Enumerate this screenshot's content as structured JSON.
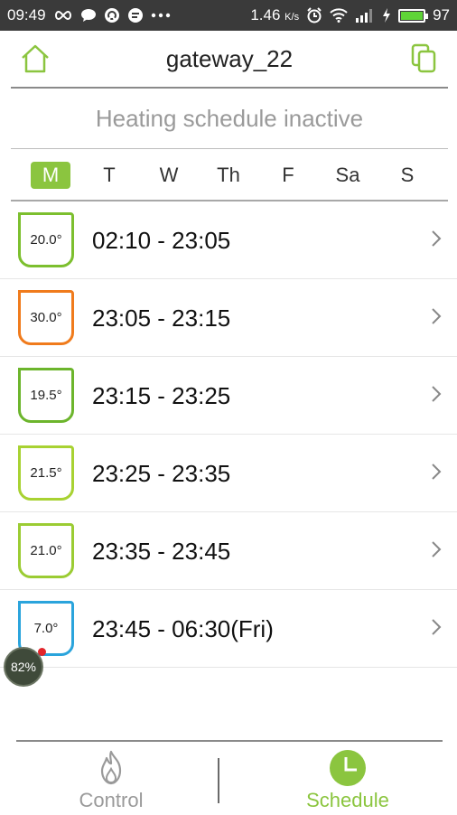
{
  "status_bar": {
    "time": "09:49",
    "speed": "1.46",
    "speed_unit": "K/s",
    "battery": "97"
  },
  "header": {
    "title": "gateway_22"
  },
  "schedule_status": "Heating schedule inactive",
  "days": [
    {
      "label": "M",
      "active": true
    },
    {
      "label": "T",
      "active": false
    },
    {
      "label": "W",
      "active": false
    },
    {
      "label": "Th",
      "active": false
    },
    {
      "label": "F",
      "active": false
    },
    {
      "label": "Sa",
      "active": false
    },
    {
      "label": "S",
      "active": false
    }
  ],
  "schedule_items": [
    {
      "temp": "20.0°",
      "time": "02:10 - 23:05",
      "color": "#7cbf2e"
    },
    {
      "temp": "30.0°",
      "time": "23:05 - 23:15",
      "color": "#f07b1c"
    },
    {
      "temp": "19.5°",
      "time": "23:15 - 23:25",
      "color": "#6cb52c"
    },
    {
      "temp": "21.5°",
      "time": "23:25 - 23:35",
      "color": "#a8d232"
    },
    {
      "temp": "21.0°",
      "time": "23:35 - 23:45",
      "color": "#9bcc33"
    },
    {
      "temp": "7.0°",
      "time": "23:45 - 06:30(Fri)",
      "color": "#2aa4dc"
    }
  ],
  "floating_badge": "82%",
  "bottom_nav": {
    "control_label": "Control",
    "schedule_label": "Schedule"
  },
  "colors": {
    "accent": "#8bc53f",
    "status_bar": "#3a3a3a"
  }
}
